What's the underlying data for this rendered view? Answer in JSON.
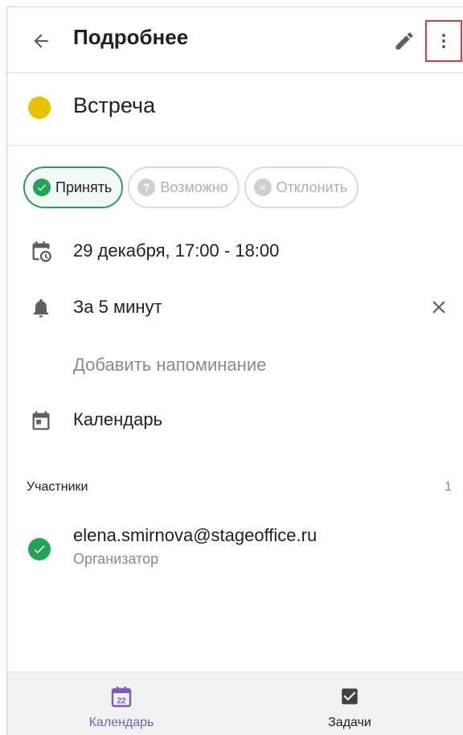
{
  "header": {
    "title": "Подробнее"
  },
  "event": {
    "title": "Встреча",
    "color": "#e8c100"
  },
  "rsvp": {
    "accept_label": "Принять",
    "maybe_label": "Возможно",
    "decline_label": "Отклонить",
    "selected": "accept"
  },
  "details": {
    "datetime": "29 декабря, 17:00 - 18:00",
    "reminder": "За 5 минут",
    "add_reminder": "Добавить напоминание",
    "calendar": "Календарь"
  },
  "participants": {
    "label": "Участники",
    "count": "1",
    "items": [
      {
        "email": "elena.smirnova@stageoffice.ru",
        "role": "Организатор"
      }
    ]
  },
  "bottom_nav": {
    "calendar_label": "Календарь",
    "calendar_day": "22",
    "tasks_label": "Задачи",
    "active": "calendar"
  },
  "colors": {
    "accent": "#7b5cc4",
    "accept": "#22a356",
    "highlight_box": "#e53935"
  },
  "icons": [
    "back-arrow-icon",
    "pencil-icon",
    "more-vert-icon",
    "check-circle-icon",
    "help-circle-icon",
    "cancel-circle-icon",
    "calendar-clock-icon",
    "bell-icon",
    "close-icon",
    "calendar-icon",
    "calendar-day-icon",
    "checkbox-icon"
  ]
}
